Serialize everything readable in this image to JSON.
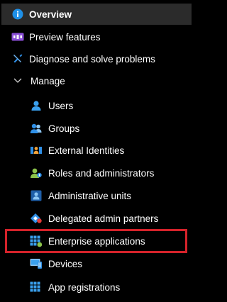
{
  "nav": {
    "overview": {
      "label": "Overview",
      "icon": "info-icon"
    },
    "preview": {
      "label": "Preview features",
      "icon": "preview-features-icon"
    },
    "diagnose": {
      "label": "Diagnose and solve problems",
      "icon": "wrench-icon"
    },
    "manage": {
      "label": "Manage",
      "icon": "chevron-down-icon",
      "expanded": true
    },
    "items": [
      {
        "label": "Users",
        "icon": "user-icon"
      },
      {
        "label": "Groups",
        "icon": "groups-icon"
      },
      {
        "label": "External Identities",
        "icon": "external-identities-icon"
      },
      {
        "label": "Roles and administrators",
        "icon": "roles-icon"
      },
      {
        "label": "Administrative units",
        "icon": "administrative-units-icon"
      },
      {
        "label": "Delegated admin partners",
        "icon": "delegated-partners-icon"
      },
      {
        "label": "Enterprise applications",
        "icon": "enterprise-apps-icon",
        "highlighted": true
      },
      {
        "label": "Devices",
        "icon": "devices-icon"
      },
      {
        "label": "App registrations",
        "icon": "app-registrations-icon"
      }
    ]
  },
  "colors": {
    "background": "#000000",
    "selected_bg": "#2b2b2b",
    "highlight_border": "#d4222a",
    "accent_blue": "#1e90e8",
    "text": "#ffffff"
  }
}
